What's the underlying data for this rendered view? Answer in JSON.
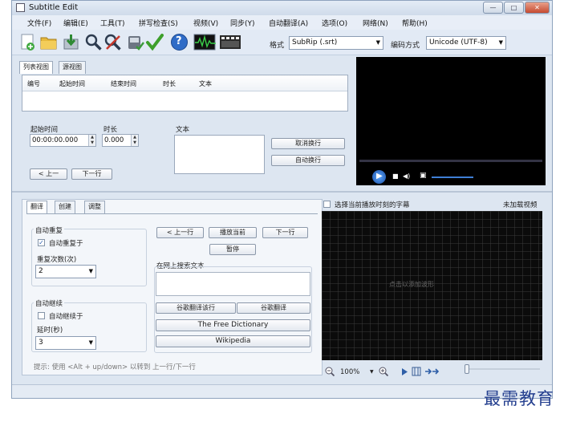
{
  "window": {
    "title": "Subtitle Edit",
    "min": "—",
    "max": "□",
    "close": "✕"
  },
  "menu": [
    "文件(F)",
    "编辑(E)",
    "工具(T)",
    "拼写检查(S)",
    "视频(V)",
    "同步(Y)",
    "自动翻译(A)",
    "选项(O)",
    "网络(N)",
    "帮助(H)"
  ],
  "toolbar": {
    "format_label": "格式",
    "format_value": "SubRip (.srt)",
    "encoding_label": "编码方式",
    "encoding_value": "Unicode (UTF-8)",
    "help_glyph": "?"
  },
  "tabs": {
    "list": "列表视图",
    "source": "源视图"
  },
  "grid": {
    "headers": [
      "编号",
      "起始时间",
      "结束时间",
      "时长",
      "文本"
    ]
  },
  "editor": {
    "start_label": "起始时间",
    "start_value": "00:00:00.000",
    "duration_label": "时长",
    "duration_value": "0.000",
    "text_label": "文本",
    "unbreak": "取消换行",
    "auto_break": "自动换行",
    "prev": "< 上一",
    "next": "下一行"
  },
  "video_controls": {
    "play": "▶",
    "stop": "■",
    "volume": "◀)",
    "fullscreen": "▣"
  },
  "bottom_tabs": [
    "翻译",
    "创建",
    "调整"
  ],
  "repeat": {
    "group": "自动重复",
    "checkbox": "自动重复于",
    "checked": true,
    "count_label": "重复次数(次)",
    "count_value": "2"
  },
  "continue": {
    "group": "自动继续",
    "checkbox": "自动继续于",
    "checked": false,
    "delay_label": "延时(秒)",
    "delay_value": "3"
  },
  "playback": {
    "prev": "< 上一行",
    "play_current": "播放当前",
    "next": "下一行",
    "pause": "暂停"
  },
  "search": {
    "label": "在网上搜索文本",
    "google_translate_line": "谷歌翻译该行",
    "google_translate": "谷歌翻译",
    "free_dictionary": "The Free Dictionary",
    "wikipedia": "Wikipedia"
  },
  "hint": "提示: 使用 <Alt + up/down> 以转到 上一行/下一行",
  "waveform": {
    "select_current": "选择当前播放时刻的字幕",
    "no_video": "未加载视频",
    "click_to_add": "点击以添加波形",
    "zoom": "100%"
  },
  "watermark": "最需教育"
}
